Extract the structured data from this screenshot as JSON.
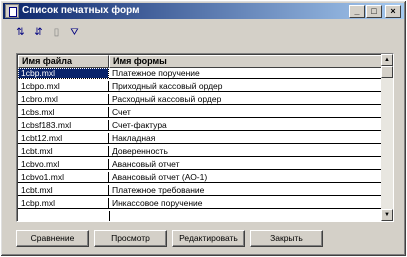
{
  "window": {
    "title": "Список печатных форм",
    "controls": {
      "minimize": "_",
      "maximize": "□",
      "close": "×"
    }
  },
  "toolbar": {
    "icons": [
      "sort-ascending-icon",
      "sort-descending-icon",
      "document-icon",
      "filter-icon"
    ],
    "glyphs": [
      "⇅",
      "⇵",
      "▯",
      "⛛"
    ]
  },
  "table": {
    "headers": {
      "file": "Имя файла",
      "form": "Имя формы"
    },
    "rows": [
      {
        "file": "1cbp.mxl",
        "form": "Платежное поручение"
      },
      {
        "file": "1cbpo.mxl",
        "form": "Приходный кассовый ордер"
      },
      {
        "file": "1cbro.mxl",
        "form": "Расходный кассовый ордер"
      },
      {
        "file": "1cbs.mxl",
        "form": "Счет"
      },
      {
        "file": "1cbsf183.mxl",
        "form": "Счет-фактура"
      },
      {
        "file": "1cbt12.mxl",
        "form": "Накладная"
      },
      {
        "file": "1cbt.mxl",
        "form": "Доверенность"
      },
      {
        "file": "1cbvo.mxl",
        "form": "Авансовый отчет"
      },
      {
        "file": "1cbvo1.mxl",
        "form": "Авансовый отчет (АО-1)"
      },
      {
        "file": "1cbt.mxl",
        "form": "Платежное требование"
      },
      {
        "file": "1cbp.mxl",
        "form": "Инкассовое поручение"
      }
    ],
    "selected_index": 0,
    "scroll": {
      "up": "▲",
      "down": "▼"
    }
  },
  "buttons": {
    "edit": "Сравнение",
    "view": "Просмотр",
    "redact": "Редактировать",
    "close": "Закрыть"
  },
  "colors": {
    "title_gradient_start": "#0a246a",
    "title_gradient_end": "#a6caf0",
    "face": "#d4d0c8",
    "selection": "#0a246a"
  }
}
